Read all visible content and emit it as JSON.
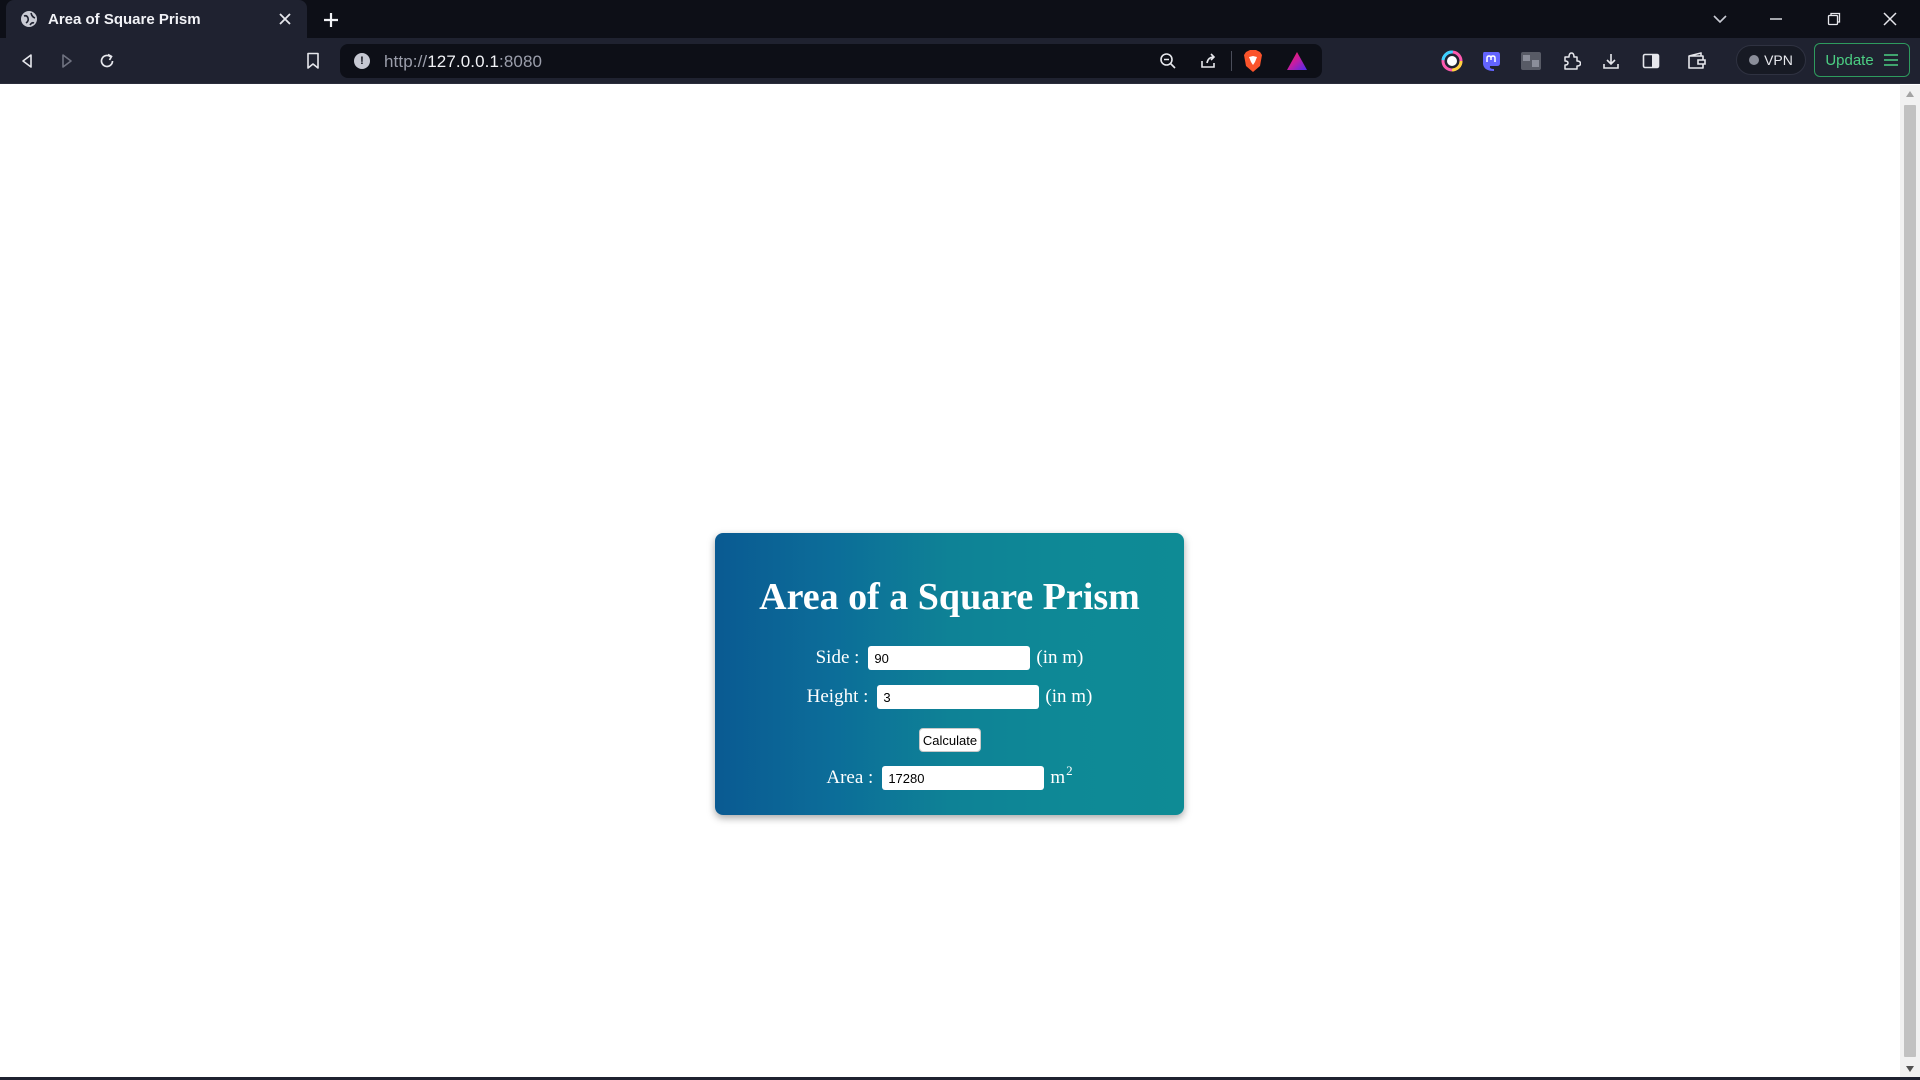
{
  "browser": {
    "tab": {
      "title": "Area of Square Prism",
      "favicon": "globe-icon"
    },
    "url": {
      "scheme": "http://",
      "host": "127.0.0.1",
      "port": ":8080"
    },
    "vpn_label": "VPN",
    "update_label": "Update"
  },
  "page": {
    "title": "Area of a Square Prism",
    "side": {
      "label": "Side :",
      "value": "90",
      "unit": "(in m)"
    },
    "height": {
      "label": "Height :",
      "value": "3",
      "unit": "(in m)"
    },
    "calculate_label": "Calculate",
    "area": {
      "label": "Area :",
      "value": "17280",
      "unit": "m",
      "unit_exponent": "2"
    }
  },
  "colors": {
    "card_gradient_start": "#0a5a92",
    "card_gradient_end": "#0e8b95",
    "update_accent": "#4ccf83",
    "browser_dark": "#0d0f17",
    "browser_toolbar": "#1f2230"
  }
}
